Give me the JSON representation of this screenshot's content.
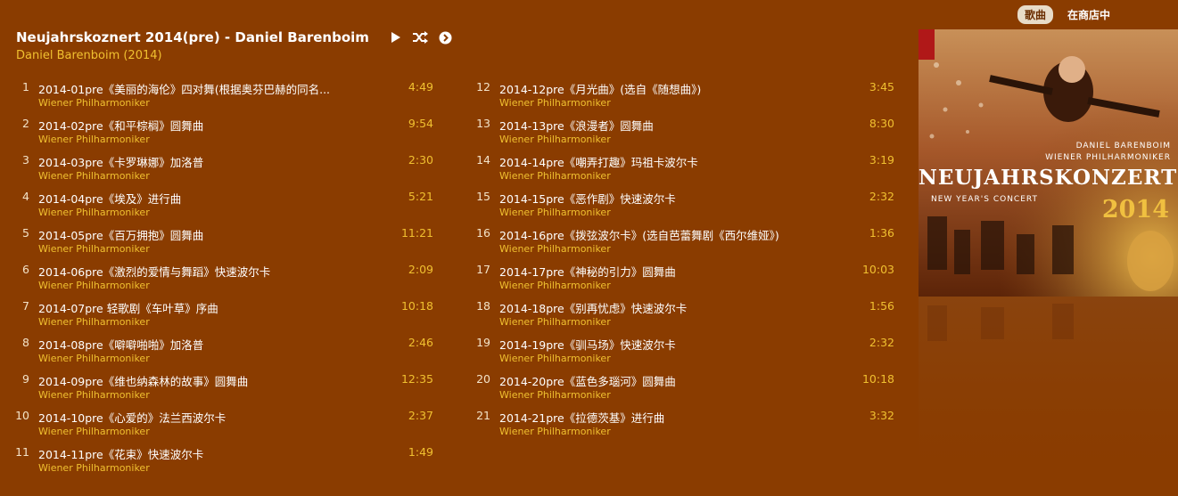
{
  "tabs": {
    "songs": "歌曲",
    "in_store": "在商店中"
  },
  "album": {
    "title": "Neujahrskoznert 2014(pre) - Daniel Barenboim",
    "artist_line": "Daniel Barenboim (2014)"
  },
  "cover": {
    "conductor": "DANIEL BARENBOIM",
    "orchestra": "WIENER PHILHARMONIKER",
    "main_title": "NEUJAHRSKONZERT",
    "subtitle": "NEW YEAR'S CONCERT",
    "year": "2014"
  },
  "colors": {
    "background": "#8a3c00",
    "accent": "#f0c030"
  },
  "icons": [
    "play-icon",
    "shuffle-icon",
    "next-icon"
  ],
  "tracks": [
    {
      "num": "1",
      "title": "2014-01pre《美丽的海伦》四对舞(根据奥芬巴赫的同名...",
      "artist": "Wiener Philharmoniker",
      "duration": "4:49"
    },
    {
      "num": "2",
      "title": "2014-02pre《和平棕榈》圆舞曲",
      "artist": "Wiener Philharmoniker",
      "duration": "9:54"
    },
    {
      "num": "3",
      "title": "2014-03pre《卡罗琳娜》加洛普",
      "artist": "Wiener Philharmoniker",
      "duration": "2:30"
    },
    {
      "num": "4",
      "title": "2014-04pre《埃及》进行曲",
      "artist": "Wiener Philharmoniker",
      "duration": "5:21"
    },
    {
      "num": "5",
      "title": "2014-05pre《百万拥抱》圆舞曲",
      "artist": "Wiener Philharmoniker",
      "duration": "11:21"
    },
    {
      "num": "6",
      "title": "2014-06pre《激烈的爱情与舞蹈》快速波尔卡",
      "artist": "Wiener Philharmoniker",
      "duration": "2:09"
    },
    {
      "num": "7",
      "title": "2014-07pre 轻歌剧《车叶草》序曲",
      "artist": "Wiener Philharmoniker",
      "duration": "10:18"
    },
    {
      "num": "8",
      "title": "2014-08pre《噼噼啪啪》加洛普",
      "artist": "Wiener Philharmoniker",
      "duration": "2:46"
    },
    {
      "num": "9",
      "title": "2014-09pre《维也纳森林的故事》圆舞曲",
      "artist": "Wiener Philharmoniker",
      "duration": "12:35"
    },
    {
      "num": "10",
      "title": "2014-10pre《心爱的》法兰西波尔卡",
      "artist": "Wiener Philharmoniker",
      "duration": "2:37"
    },
    {
      "num": "11",
      "title": "2014-11pre《花束》快速波尔卡",
      "artist": "Wiener Philharmoniker",
      "duration": "1:49"
    },
    {
      "num": "12",
      "title": "2014-12pre《月光曲》(选自《随想曲》)",
      "artist": "Wiener Philharmoniker",
      "duration": "3:45"
    },
    {
      "num": "13",
      "title": "2014-13pre《浪漫者》圆舞曲",
      "artist": "Wiener Philharmoniker",
      "duration": "8:30"
    },
    {
      "num": "14",
      "title": "2014-14pre《嘲弄打趣》玛祖卡波尔卡",
      "artist": "Wiener Philharmoniker",
      "duration": "3:19"
    },
    {
      "num": "15",
      "title": "2014-15pre《恶作剧》快速波尔卡",
      "artist": "Wiener Philharmoniker",
      "duration": "2:32"
    },
    {
      "num": "16",
      "title": "2014-16pre《拨弦波尔卡》(选自芭蕾舞剧《西尔维娅》)",
      "artist": "Wiener Philharmoniker",
      "duration": "1:36"
    },
    {
      "num": "17",
      "title": "2014-17pre《神秘的引力》圆舞曲",
      "artist": "Wiener Philharmoniker",
      "duration": "10:03"
    },
    {
      "num": "18",
      "title": "2014-18pre《别再忧虑》快速波尔卡",
      "artist": "Wiener Philharmoniker",
      "duration": "1:56"
    },
    {
      "num": "19",
      "title": "2014-19pre《驯马场》快速波尔卡",
      "artist": "Wiener Philharmoniker",
      "duration": "2:32"
    },
    {
      "num": "20",
      "title": "2014-20pre《蓝色多瑙河》圆舞曲",
      "artist": "Wiener Philharmoniker",
      "duration": "10:18"
    },
    {
      "num": "21",
      "title": "2014-21pre《拉德茨基》进行曲",
      "artist": "Wiener Philharmoniker",
      "duration": "3:32"
    }
  ]
}
